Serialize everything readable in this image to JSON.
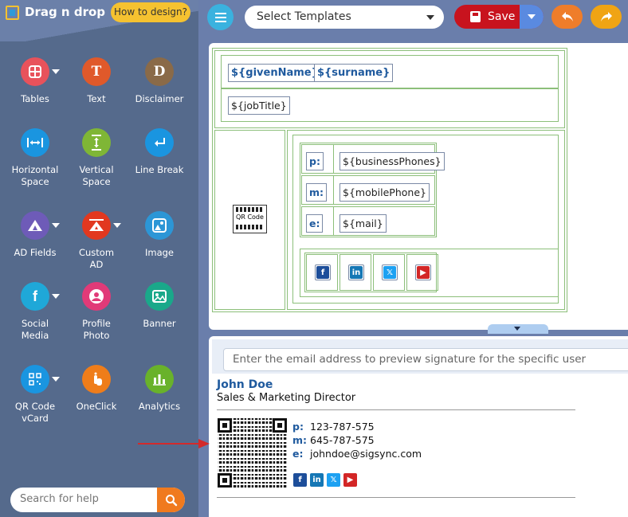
{
  "app": {
    "title": "Drag n drop",
    "how_to": "How to design?"
  },
  "tools": [
    {
      "label": "Tables",
      "icon": "grid-icon",
      "color": "#e8525b",
      "dropdown": true
    },
    {
      "label": "Text",
      "icon": "T",
      "color": "#e0592a",
      "dropdown": false
    },
    {
      "label": "Disclaimer",
      "icon": "D",
      "color": "#8a6a48",
      "dropdown": false
    },
    {
      "label": "Horizontal Space",
      "icon": "horizontal-space-icon",
      "color": "#1a95e0",
      "dropdown": false
    },
    {
      "label": "Vertical Space",
      "icon": "vertical-space-icon",
      "color": "#7fb636",
      "dropdown": false
    },
    {
      "label": "Line Break",
      "icon": "line-break-icon",
      "color": "#1a95e0",
      "dropdown": false
    },
    {
      "label": "AD Fields",
      "icon": "ad-fields-icon",
      "color": "#6e5bb8",
      "dropdown": true
    },
    {
      "label": "Custom AD",
      "icon": "custom-ad-icon",
      "color": "#e2381f",
      "dropdown": true
    },
    {
      "label": "Image",
      "icon": "image-icon",
      "color": "#2c96d6",
      "dropdown": false
    },
    {
      "label": "Social Media",
      "icon": "facebook-icon",
      "color": "#1fa8d8",
      "dropdown": true
    },
    {
      "label": "Profile Photo",
      "icon": "profile-photo-icon",
      "color": "#e13a78",
      "dropdown": false
    },
    {
      "label": "Banner",
      "icon": "banner-icon",
      "color": "#1aa88a",
      "dropdown": false
    },
    {
      "label": "QR Code vCard",
      "icon": "qr-code-icon",
      "color": "#1a95e0",
      "dropdown": true
    },
    {
      "label": "OneClick",
      "icon": "oneclick-icon",
      "color": "#ef7d1a",
      "dropdown": false
    },
    {
      "label": "Analytics",
      "icon": "analytics-icon",
      "color": "#69b22a",
      "dropdown": false
    }
  ],
  "search_help": {
    "placeholder": "Search for help"
  },
  "toolbar": {
    "templates": "Select Templates",
    "save": "Save"
  },
  "canvas": {
    "given_name": "${givenName}",
    "surname": "${surname}",
    "job_title": "${jobTitle}",
    "qr_label": "QR Code",
    "rows": [
      {
        "key": "p:",
        "value": "${businessPhones}"
      },
      {
        "key": "m:",
        "value": "${mobilePhone}"
      },
      {
        "key": "e:",
        "value": "${mail}"
      }
    ],
    "social": [
      "facebook",
      "linkedin",
      "x",
      "youtube"
    ]
  },
  "preview": {
    "placeholder": "Enter the email address to preview signature for the specific user",
    "name": "John Doe",
    "title": "Sales & Marketing Director",
    "rows": [
      {
        "key": "p:",
        "value": "123-787-575"
      },
      {
        "key": "m:",
        "value": "645-787-575"
      },
      {
        "key": "e:",
        "value": "johndoe@sigsync.com"
      }
    ]
  },
  "colors": {
    "facebook": "#1d4e9a",
    "linkedin": "#1577b5",
    "x": "#1da1f2",
    "youtube": "#d32626",
    "accent_red": "#c8131e"
  }
}
